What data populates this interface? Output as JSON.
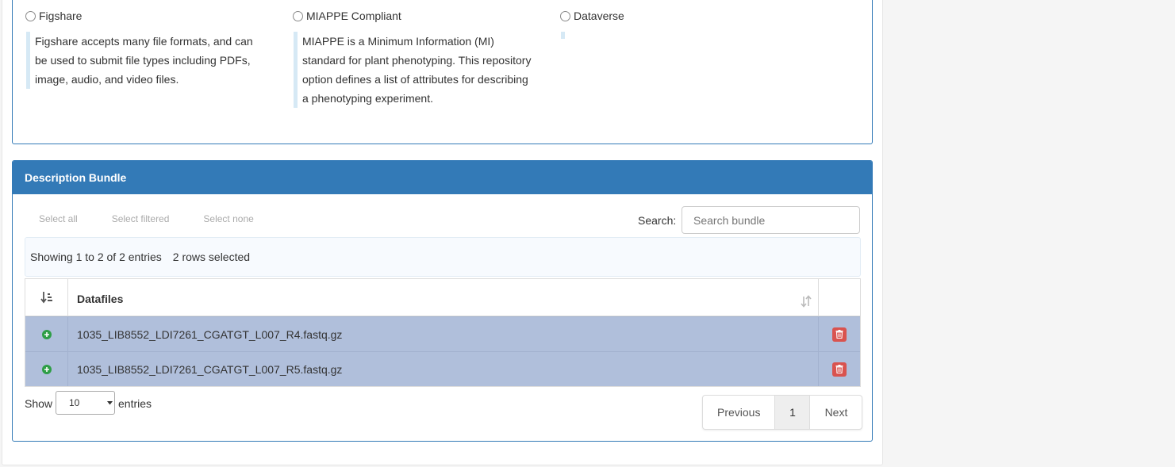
{
  "repositories": [
    {
      "label": "Figshare",
      "description": [
        "Figshare accepts many file formats, and can",
        "be used to submit file types including PDFs,",
        "image, audio, and video files."
      ]
    },
    {
      "label": "MIAPPE Compliant",
      "description": [
        "MIAPPE is a Minimum Information (MI)",
        "standard for plant phenotyping. This repository",
        "option defines a list of attributes for describing",
        "a phenotyping experiment."
      ]
    },
    {
      "label": "Dataverse",
      "description": []
    }
  ],
  "bundle": {
    "title": "Description Bundle",
    "select_all": "Select all",
    "select_filtered": "Select filtered",
    "select_none": "Select none",
    "search_label": "Search:",
    "search_placeholder": "Search bundle",
    "info": "Showing 1 to 2 of 2 entries",
    "rows_selected": "2 rows selected",
    "column_header": "Datafiles",
    "rows": [
      {
        "file": "1035_LIB8552_LDI7261_CGATGT_L007_R4.fastq.gz"
      },
      {
        "file": "1035_LIB8552_LDI7261_CGATGT_L007_R5.fastq.gz"
      }
    ],
    "show_label": "Show",
    "page_length": "10",
    "entries_label": "entries",
    "pagination": {
      "previous": "Previous",
      "current": "1",
      "next": "Next"
    }
  },
  "colors": {
    "primary": "#337ab7",
    "selected_row": "#b0bfdb",
    "delete": "#d9534f",
    "add": "#2e9e46"
  },
  "icons": [
    "radio-icon",
    "sort-numeric-icon",
    "sort-icon",
    "plus-circle-icon",
    "trash-icon",
    "dropdown-arrow-icon"
  ]
}
